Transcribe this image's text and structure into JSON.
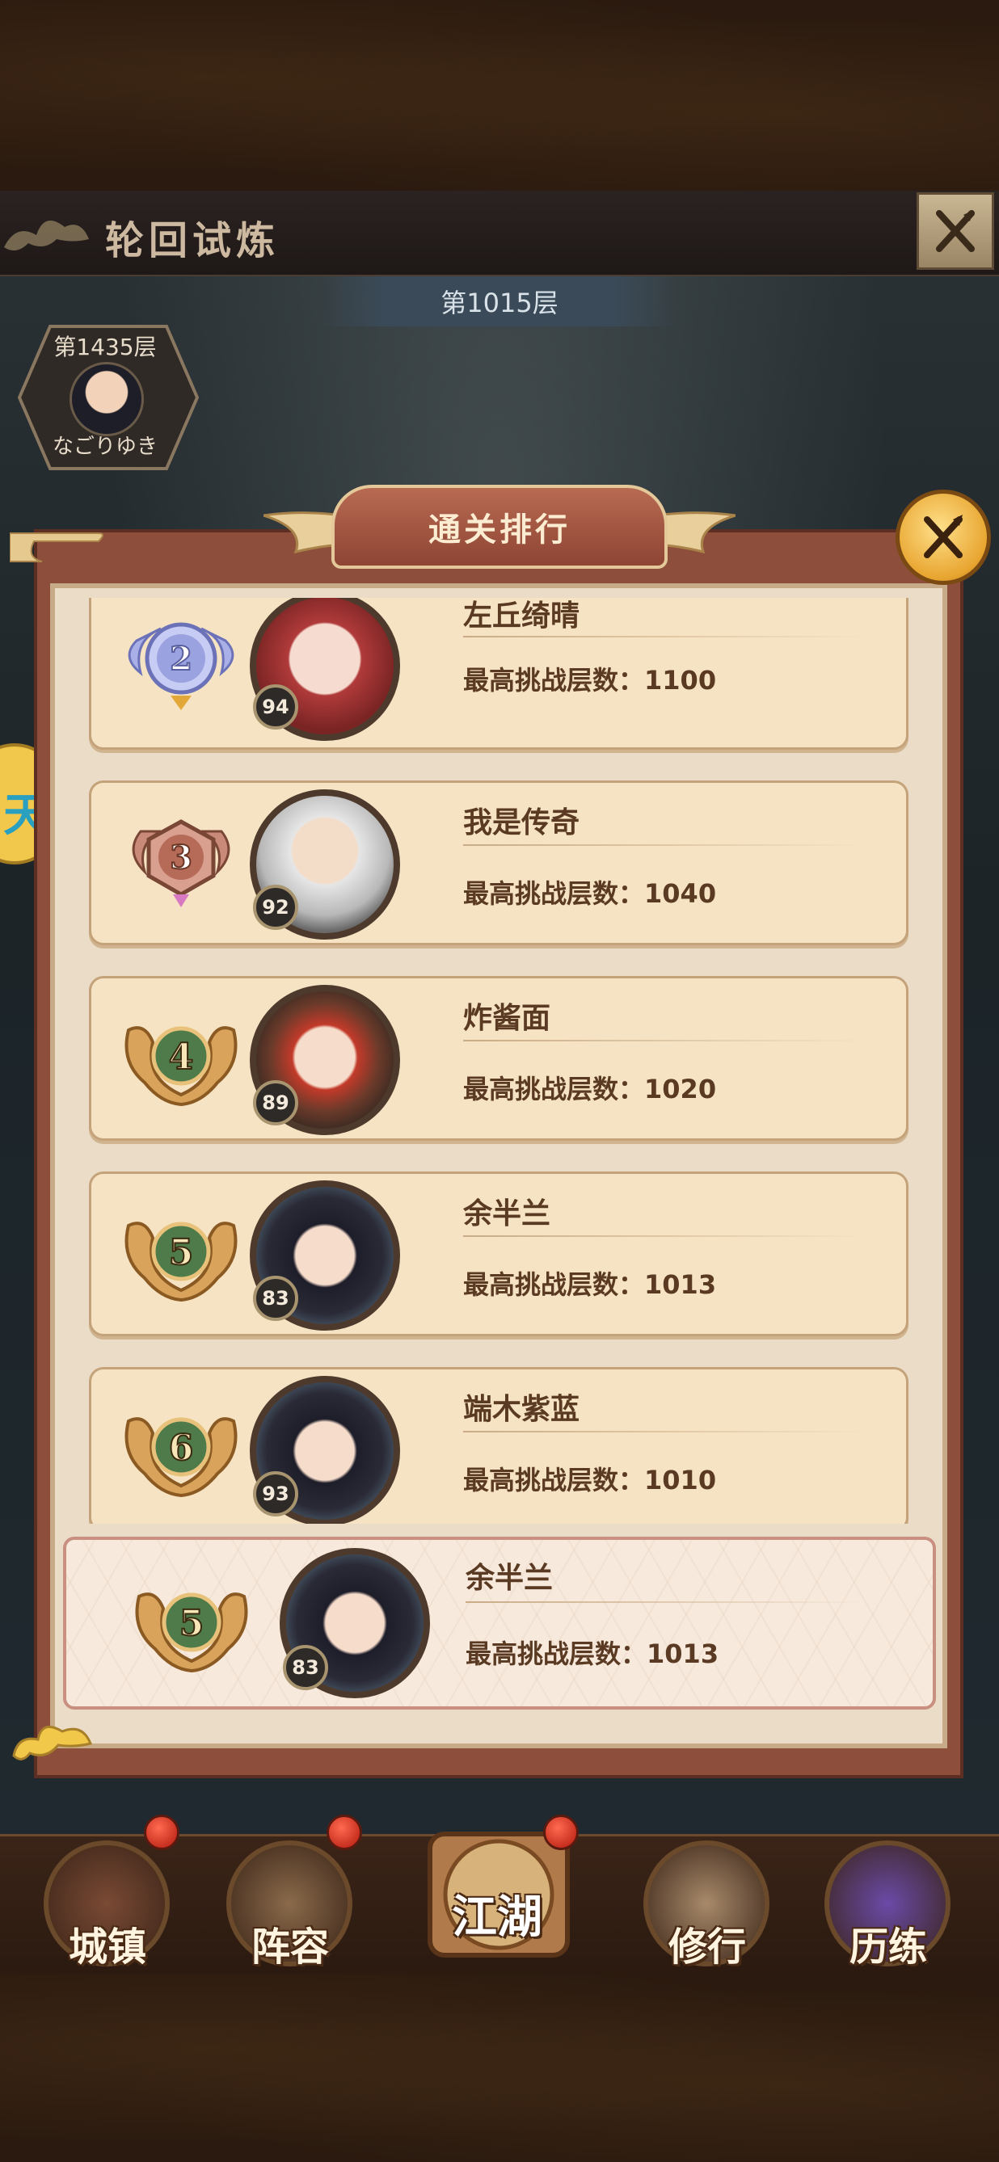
{
  "header": {
    "title": "轮回试炼",
    "current_floor": "第1015层"
  },
  "my_record": {
    "floor": "第1435层",
    "name": "なごりゆき"
  },
  "side_tab": {
    "label": "天"
  },
  "panel": {
    "title": "通关排行"
  },
  "ranking": [
    {
      "rank": "2",
      "name": "左丘绮晴",
      "level": "94",
      "score_label": "最高挑战层数：",
      "score": "1100"
    },
    {
      "rank": "3",
      "name": "我是传奇",
      "level": "92",
      "score_label": "最高挑战层数：",
      "score": "1040"
    },
    {
      "rank": "4",
      "name": "炸酱面",
      "level": "89",
      "score_label": "最高挑战层数：",
      "score": "1020"
    },
    {
      "rank": "5",
      "name": "余半兰",
      "level": "83",
      "score_label": "最高挑战层数：",
      "score": "1013"
    },
    {
      "rank": "6",
      "name": "端木紫蓝",
      "level": "93",
      "score_label": "最高挑战层数：",
      "score": "1010"
    }
  ],
  "self_rank": {
    "rank": "5",
    "name": "余半兰",
    "level": "83",
    "score_label": "最高挑战层数：",
    "score": "1013"
  },
  "nav": {
    "town": "城镇",
    "lineup": "阵容",
    "jianghu": "江湖",
    "cultivate": "修行",
    "trial": "历练"
  },
  "colors": {
    "panel_frame": "#8d4f3b",
    "card_bg": "#f6e3c3",
    "text_brown": "#5a3a22",
    "badge_silver": "#b9bff0",
    "badge_bronze": "#c98a7a",
    "badge_gold": "#d9a35c",
    "badge_green": "#4f7a4a"
  }
}
